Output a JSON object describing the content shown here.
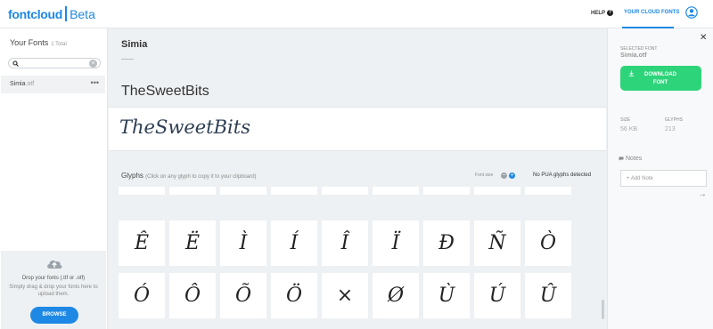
{
  "header": {
    "logo": "fontcloud",
    "logo_badge": "Beta",
    "help_label": "HELP",
    "cloud_fonts_label": "YOUR CLOUD FONTS"
  },
  "sidebar": {
    "title": "Your Fonts",
    "count": "1 Total",
    "search": {
      "value": "",
      "placeholder": ""
    },
    "fonts": [
      {
        "name": "Simia",
        "ext": ".otf"
      }
    ],
    "dropzone": {
      "line1": "Drop your fonts (.ttf or .otf)",
      "line2": "Simply drag & drop your fonts here to upload them.",
      "browse_label": "BROWSE"
    }
  },
  "main": {
    "font_title": "Simia",
    "preview_text": "TheSweetBits",
    "glyphs_label": "Glyphs",
    "glyphs_hint": "(Click on any glyph to copy it to your clipboard)",
    "font_size_label": "Font size",
    "pua_text": "No PUA glyphs detected",
    "glyphs_row1": [
      "Ê",
      "Ë",
      "Ì",
      "Í",
      "Î",
      "Ï",
      "Đ",
      "Ñ",
      "Ò"
    ],
    "glyphs_row2": [
      "Ó",
      "Ô",
      "Õ",
      "Ö",
      "×",
      "Ø",
      "Ù",
      "Ú",
      "Û"
    ]
  },
  "right_panel": {
    "selected_label": "SELECTED FONT",
    "selected_name": "Simia.otf",
    "download_label": "DOWNLOAD FONT",
    "size_label": "SIZE",
    "size_value": "56 KB",
    "glyphs_label": "GLYPHS",
    "glyphs_value": "213",
    "notes_label": "Notes",
    "notes_placeholder": "+ Add Note"
  },
  "colors": {
    "accent": "#1e88e5",
    "download": "#2ed47a",
    "background": "#eef1f3"
  }
}
